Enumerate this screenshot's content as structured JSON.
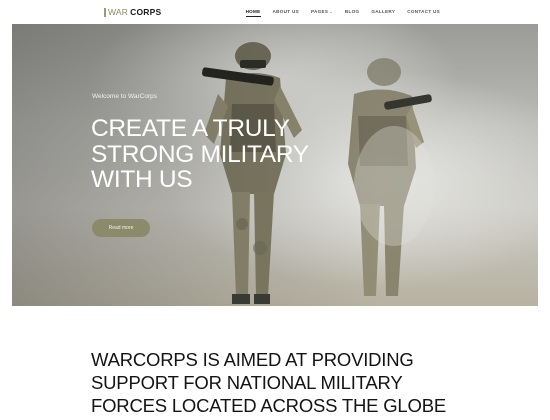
{
  "brand": {
    "part1": "WAR",
    "part2": "CORPS"
  },
  "nav": {
    "items": [
      {
        "label": "HOME"
      },
      {
        "label": "ABOUT US"
      },
      {
        "label": "PAGES"
      },
      {
        "label": "BLOG"
      },
      {
        "label": "GALLERY"
      },
      {
        "label": "CONTACT US"
      }
    ],
    "active": "HOME"
  },
  "hero": {
    "eyebrow": "Welcome to WarCorps",
    "headline": "CREATE A TRULY STRONG MILITARY WITH US",
    "cta_label": "Read more"
  },
  "about": {
    "heading": "WARCORPS IS AIMED AT PROVIDING SUPPORT FOR NATIONAL MILITARY FORCES LOCATED ACROSS THE GLOBE"
  },
  "colors": {
    "accent": "#8b8a6b",
    "text_dark": "#141414"
  }
}
